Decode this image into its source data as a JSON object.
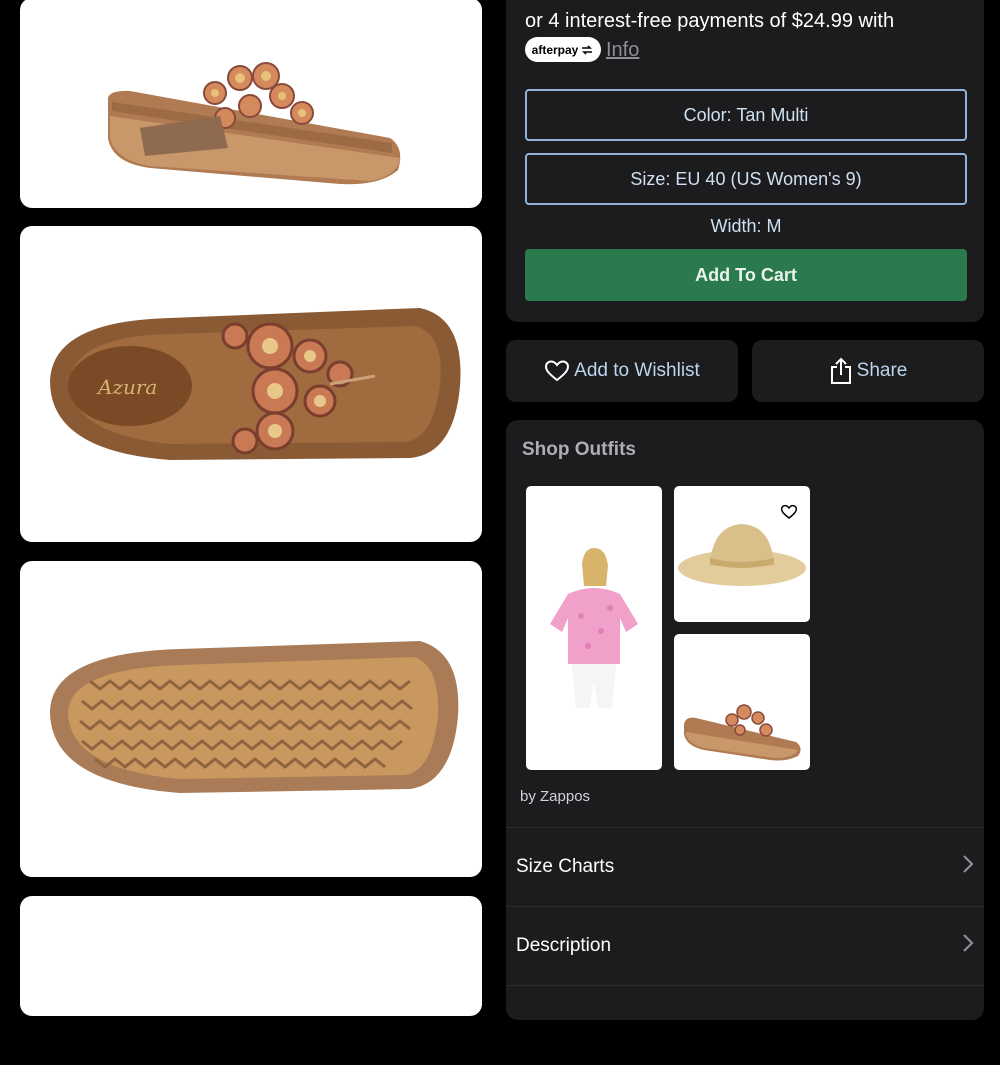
{
  "payment": {
    "installment_text": "or 4 interest-free payments of $24.99 with",
    "afterpay_label": "afterpay",
    "info_label": "Info"
  },
  "options": {
    "color_label": "Color: Tan Multi",
    "size_label": "Size: EU 40 (US Women's 9)",
    "width_label": "Width: M"
  },
  "cart": {
    "add_label": "Add To Cart"
  },
  "actions": {
    "wishlist_label": "Add to Wishlist",
    "share_label": "Share"
  },
  "outfits": {
    "title": "Shop Outfits",
    "credit": "by Zappos",
    "items": [
      "pink-blouse",
      "straw-hat",
      "beaded-sandal"
    ]
  },
  "accordion": [
    {
      "label": "Size Charts"
    },
    {
      "label": "Description"
    }
  ],
  "brand_on_insole": "Azura",
  "colors": {
    "page_bg": "#000000",
    "panel_bg": "#1c1c1e",
    "outline_blue": "#8fb3d9",
    "cart_green": "#2a7a4e"
  }
}
